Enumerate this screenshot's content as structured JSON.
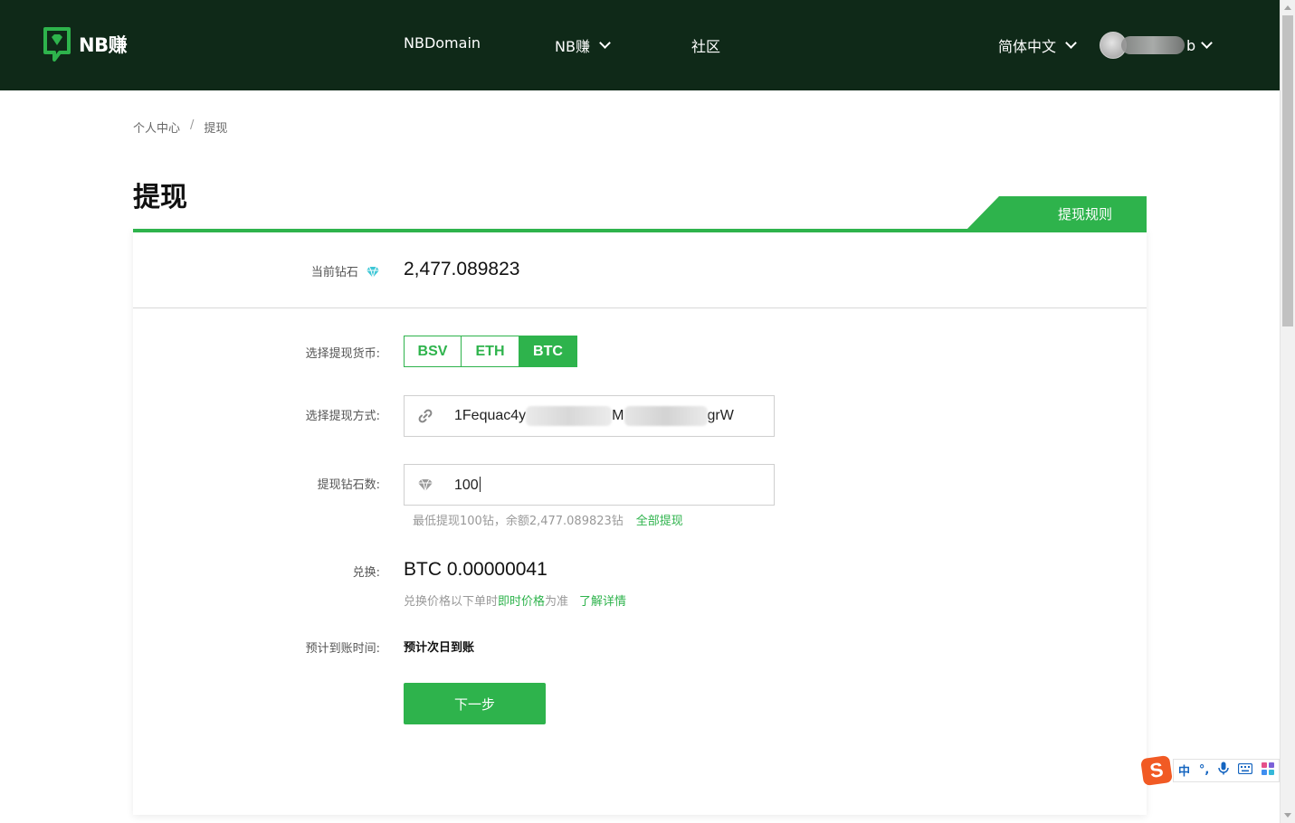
{
  "header": {
    "logo_text": "NB赚",
    "nav": {
      "nbdomain": "NBDomain",
      "nbzhuan": "NB赚",
      "community": "社区"
    },
    "language": "简体中文",
    "username_tail": "b"
  },
  "breadcrumb": {
    "home": "个人中心",
    "separator": "/",
    "current": "提现"
  },
  "page_title": "提现",
  "rules_tab": "提现规则",
  "balance": {
    "label": "当前钻石",
    "value": "2,477.089823"
  },
  "currency": {
    "label": "选择提现货币:",
    "options": [
      "BSV",
      "ETH",
      "BTC"
    ],
    "selected": "BTC"
  },
  "method": {
    "label": "选择提现方式:",
    "address_start": "1Fequac4y",
    "address_mid": "M",
    "address_end": "grW"
  },
  "amount": {
    "label": "提现钻石数:",
    "value": "100",
    "hint": "最低提现100钻，余额2,477.089823钻",
    "withdraw_all": "全部提现"
  },
  "exchange": {
    "label": "兑换:",
    "value": "BTC 0.00000041",
    "note_prefix": "兑换价格以下单时",
    "note_highlight": "即时价格",
    "note_suffix": "为准",
    "learn_more": "了解详情"
  },
  "eta": {
    "label": "预计到账时间:",
    "value": "预计次日到账"
  },
  "next_button": "下一步",
  "ime": {
    "logo": "S",
    "mode": "中",
    "punct": "°,"
  },
  "colors": {
    "header_bg": "#0f2918",
    "accent": "#2eb34c",
    "ime_orange": "#f15a24",
    "diamond": "#3ec7d6"
  }
}
